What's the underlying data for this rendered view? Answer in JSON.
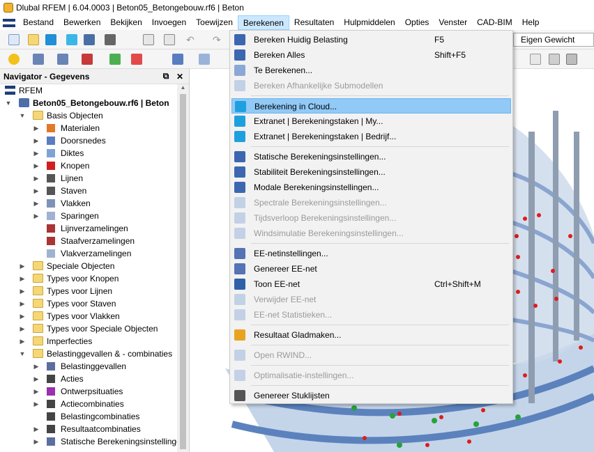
{
  "window": {
    "title": "Dlubal RFEM | 6.04.0003 | Beton05_Betongebouw.rf6 | Beton"
  },
  "menubar": {
    "items": [
      "Bestand",
      "Bewerken",
      "Bekijken",
      "Invoegen",
      "Toewijzen",
      "Berekenen",
      "Resultaten",
      "Hulpmiddelen",
      "Opties",
      "Venster",
      "CAD-BIM",
      "Help"
    ],
    "active": "Berekenen"
  },
  "toolbar": {
    "loadcase_combo": "Eigen Gewicht"
  },
  "navigator": {
    "title": "Navigator - Gegevens",
    "root": "RFEM",
    "model": "Beton05_Betongebouw.rf6 | Beton",
    "items": [
      {
        "label": "Basis Objecten",
        "level": 1,
        "expanded": true,
        "icon": "folder-icon"
      },
      {
        "label": "Materialen",
        "level": 2,
        "icon": "materials-icon"
      },
      {
        "label": "Doorsnedes",
        "level": 2,
        "icon": "sections-icon"
      },
      {
        "label": "Diktes",
        "level": 2,
        "icon": "thickness-icon"
      },
      {
        "label": "Knopen",
        "level": 2,
        "icon": "node-icon"
      },
      {
        "label": "Lijnen",
        "level": 2,
        "icon": "line-icon"
      },
      {
        "label": "Staven",
        "level": 2,
        "icon": "member-icon"
      },
      {
        "label": "Vlakken",
        "level": 2,
        "icon": "surface-icon"
      },
      {
        "label": "Sparingen",
        "level": 2,
        "icon": "opening-icon"
      },
      {
        "label": "Lijnverzamelingen",
        "level": 2,
        "leaf": true,
        "icon": "line-set-icon"
      },
      {
        "label": "Staafverzamelingen",
        "level": 2,
        "leaf": true,
        "icon": "member-set-icon"
      },
      {
        "label": "Vlakverzamelingen",
        "level": 2,
        "leaf": true,
        "icon": "surface-set-icon"
      },
      {
        "label": "Speciale Objecten",
        "level": 1,
        "icon": "folder-icon"
      },
      {
        "label": "Types voor Knopen",
        "level": 1,
        "icon": "folder-icon"
      },
      {
        "label": "Types voor Lijnen",
        "level": 1,
        "icon": "folder-icon"
      },
      {
        "label": "Types voor Staven",
        "level": 1,
        "icon": "folder-icon"
      },
      {
        "label": "Types voor Vlakken",
        "level": 1,
        "icon": "folder-icon"
      },
      {
        "label": "Types voor Speciale Objecten",
        "level": 1,
        "icon": "folder-icon"
      },
      {
        "label": "Imperfecties",
        "level": 1,
        "icon": "folder-icon"
      },
      {
        "label": "Belastinggevallen & - combinaties",
        "level": 1,
        "expanded": true,
        "icon": "folder-icon"
      },
      {
        "label": "Belastinggevallen",
        "level": 2,
        "icon": "load-case-icon"
      },
      {
        "label": "Acties",
        "level": 2,
        "icon": "actions-icon"
      },
      {
        "label": "Ontwerpsituaties",
        "level": 2,
        "icon": "design-situation-icon"
      },
      {
        "label": "Actiecombinaties",
        "level": 2,
        "icon": "action-combination-icon"
      },
      {
        "label": "Belastingcombinaties",
        "level": 2,
        "leaf": true,
        "icon": "load-combination-icon"
      },
      {
        "label": "Resultaatcombinaties",
        "level": 2,
        "icon": "result-combination-icon"
      },
      {
        "label": "Statische Berekeningsinstellingen",
        "level": 2,
        "icon": "static-settings-icon"
      }
    ]
  },
  "dropdown": {
    "items": [
      {
        "label": "Bereken Huidig Belasting",
        "shortcut": "F5",
        "icon": "calculate-current-icon"
      },
      {
        "label": "Bereken Alles",
        "shortcut": "Shift+F5",
        "icon": "calculate-all-icon"
      },
      {
        "label": "Te Berekenen...",
        "icon": "to-calculate-icon"
      },
      {
        "label": "Bereken Afhankelijke Submodellen",
        "disabled": true,
        "icon": "submodels-icon"
      },
      {
        "sep": true
      },
      {
        "label": "Berekening in Cloud...",
        "hover": true,
        "icon": "cloud-icon"
      },
      {
        "label": "Extranet | Berekeningstaken | My...",
        "icon": "extranet-my-icon"
      },
      {
        "label": "Extranet | Berekeningstaken | Bedrijf...",
        "icon": "extranet-company-icon"
      },
      {
        "sep": true
      },
      {
        "label": "Statische Berekeningsinstellingen...",
        "icon": "static-settings-icon"
      },
      {
        "label": "Stabiliteit Berekeningsinstellingen...",
        "icon": "stability-settings-icon"
      },
      {
        "label": "Modale Berekeningsinstellingen...",
        "icon": "modal-settings-icon"
      },
      {
        "label": "Spectrale Berekeningsinstellingen...",
        "disabled": true,
        "icon": "spectral-settings-icon"
      },
      {
        "label": "Tijdsverloop Berekeningsinstellingen...",
        "disabled": true,
        "icon": "time-history-settings-icon"
      },
      {
        "label": "Windsimulatie Berekeningsinstellingen...",
        "disabled": true,
        "icon": "wind-settings-icon"
      },
      {
        "sep": true
      },
      {
        "label": "EE-netinstellingen...",
        "icon": "mesh-settings-icon"
      },
      {
        "label": "Genereer EE-net",
        "icon": "generate-mesh-icon"
      },
      {
        "label": "Toon EE-net",
        "shortcut": "Ctrl+Shift+M",
        "icon": "show-mesh-icon"
      },
      {
        "label": "Verwijder EE-net",
        "disabled": true,
        "icon": "delete-mesh-icon"
      },
      {
        "label": "EE-net Statistieken...",
        "disabled": true,
        "icon": "mesh-statistics-icon"
      },
      {
        "sep": true
      },
      {
        "label": "Resultaat Gladmaken...",
        "icon": "smooth-results-icon"
      },
      {
        "sep": true
      },
      {
        "label": "Open RWIND...",
        "disabled": true,
        "icon": "rwind-icon"
      },
      {
        "sep": true
      },
      {
        "label": "Optimalisatie-instellingen...",
        "disabled": true,
        "icon": "optimization-icon"
      },
      {
        "sep": true
      },
      {
        "label": "Genereer Stuklijsten",
        "icon": "parts-list-icon"
      }
    ]
  }
}
